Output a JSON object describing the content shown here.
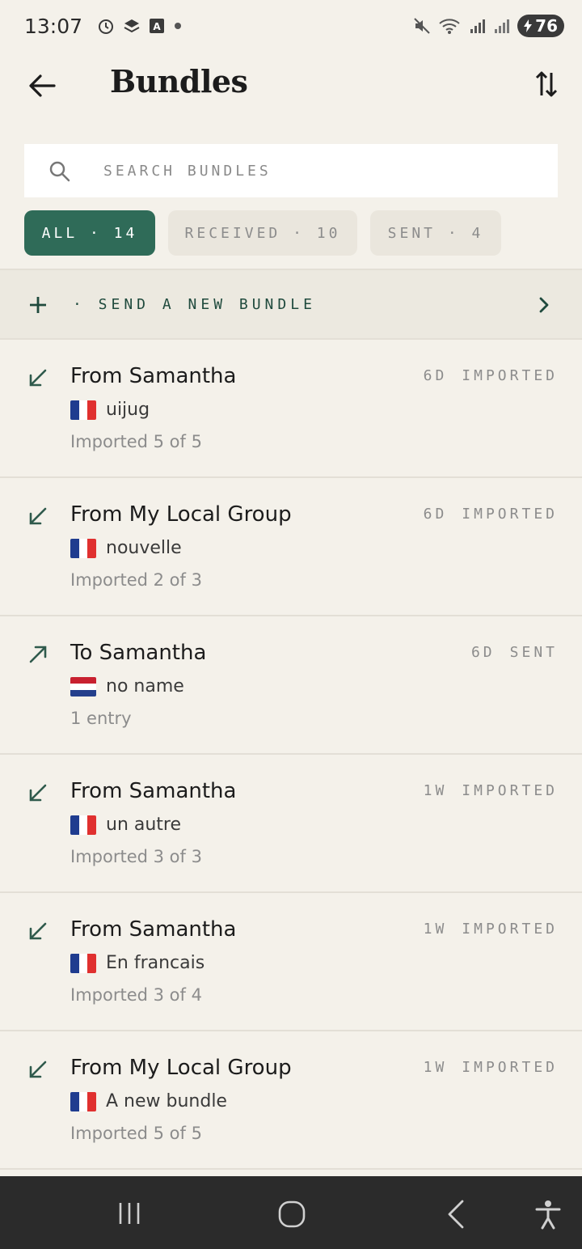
{
  "status_bar": {
    "time": "13:07",
    "battery": "76",
    "icons": [
      "alarm-icon",
      "stack-icon",
      "a-icon",
      "dot-icon",
      "mute-icon",
      "wifi-icon",
      "signal-icon",
      "signal-icon"
    ]
  },
  "header": {
    "title": "Bundles",
    "back_icon": "arrow-left-icon",
    "sort_icon": "sort-arrows-icon"
  },
  "search": {
    "placeholder": "SEARCH BUNDLES",
    "value": ""
  },
  "filters": [
    {
      "label": "ALL · 14",
      "selected": true
    },
    {
      "label": "RECEIVED · 10",
      "selected": false
    },
    {
      "label": "SENT · 4",
      "selected": false
    }
  ],
  "send_new": {
    "label": "· SEND A NEW BUNDLE"
  },
  "bundles": [
    {
      "direction": "in",
      "title": "From Samantha",
      "age": "6D",
      "state": "IMPORTED",
      "flag": "fr",
      "name": "uijug",
      "status": "Imported 5 of 5"
    },
    {
      "direction": "in",
      "title": "From My Local Group",
      "age": "6D",
      "state": "IMPORTED",
      "flag": "fr",
      "name": "nouvelle",
      "status": "Imported 2 of 3"
    },
    {
      "direction": "out",
      "title": "To Samantha",
      "age": "6D",
      "state": "SENT",
      "flag": "nl",
      "name": "no name",
      "status": "1 entry"
    },
    {
      "direction": "in",
      "title": "From Samantha",
      "age": "1W",
      "state": "IMPORTED",
      "flag": "fr",
      "name": "un autre",
      "status": "Imported 3 of 3"
    },
    {
      "direction": "in",
      "title": "From Samantha",
      "age": "1W",
      "state": "IMPORTED",
      "flag": "fr",
      "name": "En francais",
      "status": "Imported 3 of 4"
    },
    {
      "direction": "in",
      "title": "From My Local Group",
      "age": "1W",
      "state": "IMPORTED",
      "flag": "fr",
      "name": "A new bundle",
      "status": "Imported 5 of 5"
    }
  ],
  "colors": {
    "background": "#f4f1ea",
    "accent": "#2f6b58",
    "chip_inactive": "#eae6dd",
    "arrow": "#2f5a4c"
  }
}
